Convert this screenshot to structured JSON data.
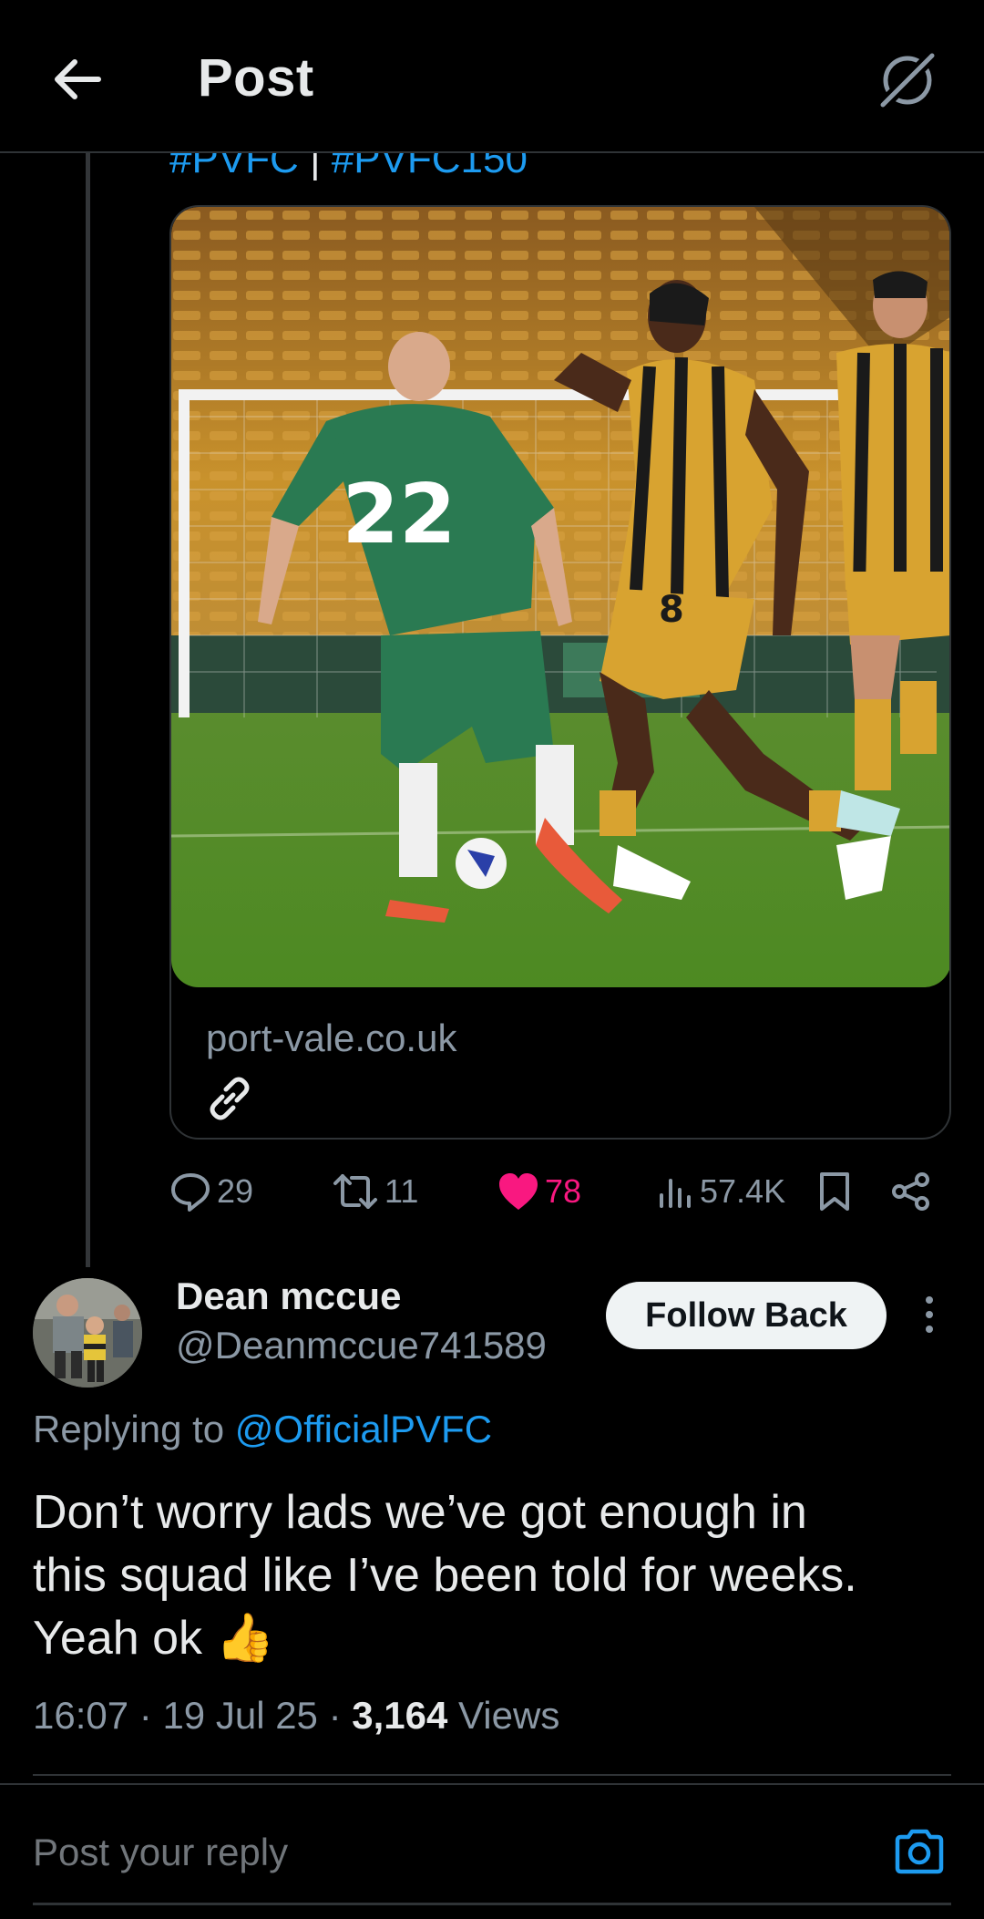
{
  "header": {
    "title": "Post",
    "back_icon": "arrow-left-icon",
    "grok_icon": "grok-icon"
  },
  "original_post": {
    "hashtags": [
      "#PVFC",
      "#PVFC150"
    ],
    "hashtag_separator": "|",
    "card": {
      "domain": "port-vale.co.uk",
      "image_desc": "football-match-photo",
      "image_caption": [
        "22",
        "8"
      ]
    },
    "stats": {
      "replies": "29",
      "reposts": "11",
      "likes": "78",
      "views": "57.4K"
    }
  },
  "reply": {
    "display_name": "Dean mccue",
    "handle": "@Deanmccue741589",
    "follow_label": "Follow Back",
    "replying_prefix": "Replying to ",
    "replying_to": "@OfficialPVFC",
    "text_line1": "Don’t worry lads we’ve got enough in",
    "text_line2": "this squad like I’ve been told for weeks.",
    "text_line3": "Yeah ok 👍",
    "time": "16:07",
    "date": "19 Jul 25",
    "views_count": "3,164",
    "views_label": "Views",
    "meta_separator": "·"
  },
  "composer": {
    "placeholder": "Post your reply"
  },
  "colors": {
    "background": "#000000",
    "accent": "#1d9bf0",
    "like": "#f91880",
    "muted": "#8b98a5"
  }
}
